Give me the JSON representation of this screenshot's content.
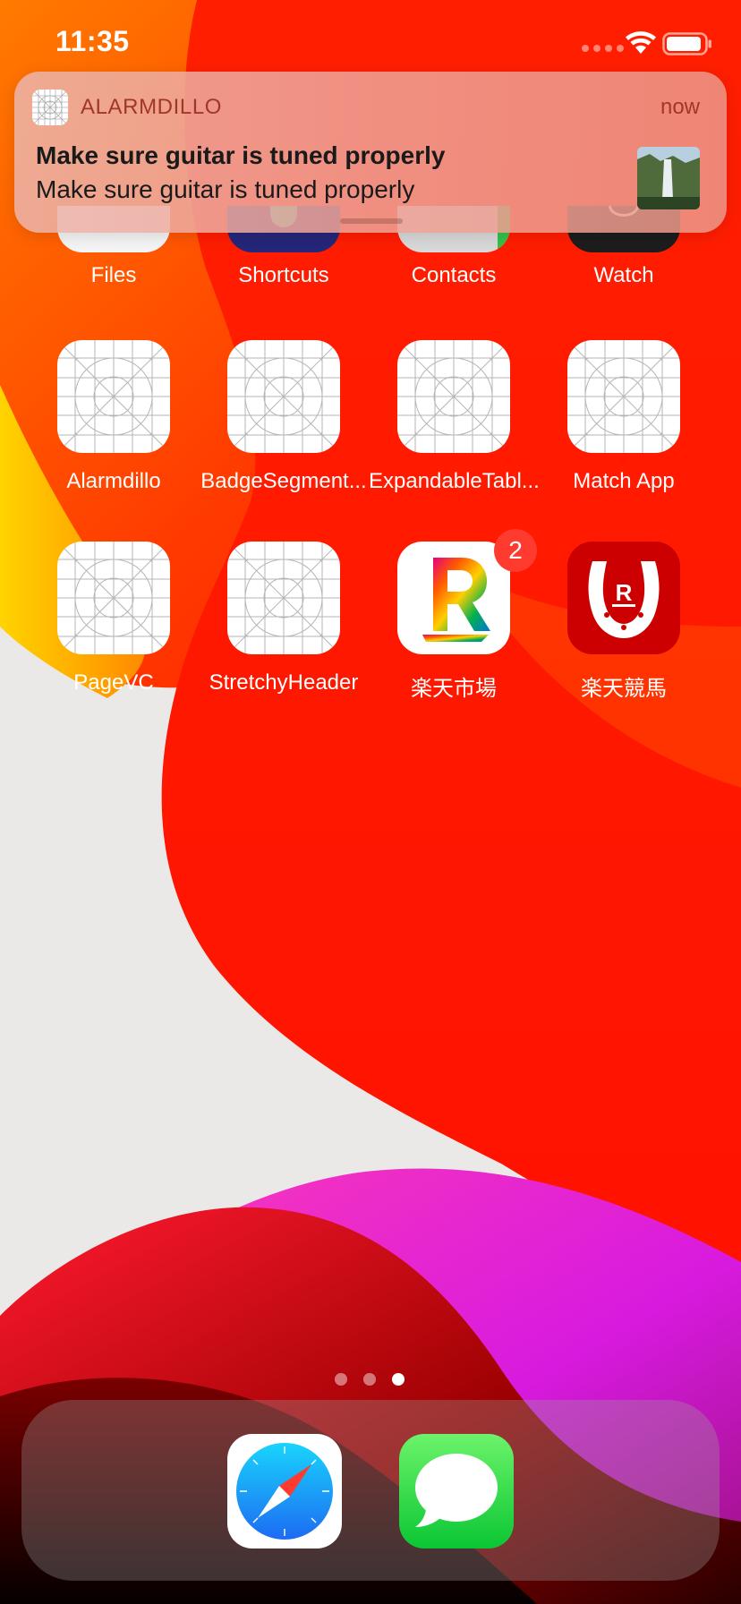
{
  "status_bar": {
    "time": "11:35"
  },
  "notification": {
    "app_name": "ALARMDILLO",
    "time": "now",
    "title": "Make sure guitar is tuned properly",
    "body": "Make sure guitar is tuned properly"
  },
  "home_screen": {
    "row_partial": [
      {
        "label": "Files",
        "icon": "files-icon"
      },
      {
        "label": "Shortcuts",
        "icon": "shortcuts-icon"
      },
      {
        "label": "Contacts",
        "icon": "contacts-icon"
      },
      {
        "label": "Watch",
        "icon": "watch-icon"
      }
    ],
    "row2": [
      {
        "label": "Alarmdillo",
        "icon": "placeholder-app-icon"
      },
      {
        "label": "BadgeSegment...",
        "icon": "placeholder-app-icon"
      },
      {
        "label": "ExpandableTabl...",
        "icon": "placeholder-app-icon"
      },
      {
        "label": "Match App",
        "icon": "placeholder-app-icon"
      }
    ],
    "row3": [
      {
        "label": "PageVC",
        "icon": "placeholder-app-icon"
      },
      {
        "label": "StretchyHeader",
        "icon": "placeholder-app-icon"
      },
      {
        "label": "楽天市場",
        "icon": "rakuten-ichiba-icon",
        "badge": "2"
      },
      {
        "label": "楽天競馬",
        "icon": "rakuten-keiba-icon"
      }
    ]
  },
  "page_indicator": {
    "pages": 3,
    "current": 3
  },
  "dock": {
    "apps": [
      {
        "name": "Safari",
        "icon": "safari-icon"
      },
      {
        "name": "Messages",
        "icon": "messages-icon"
      }
    ]
  },
  "colors": {
    "wallpaper_red": "#ff1a00",
    "wallpaper_orange": "#ff5a00",
    "wallpaper_yellow": "#ffd100",
    "wallpaper_magenta": "#e21ecf",
    "badge": "#ff3b30",
    "notification_app_name": "#a1372a"
  }
}
